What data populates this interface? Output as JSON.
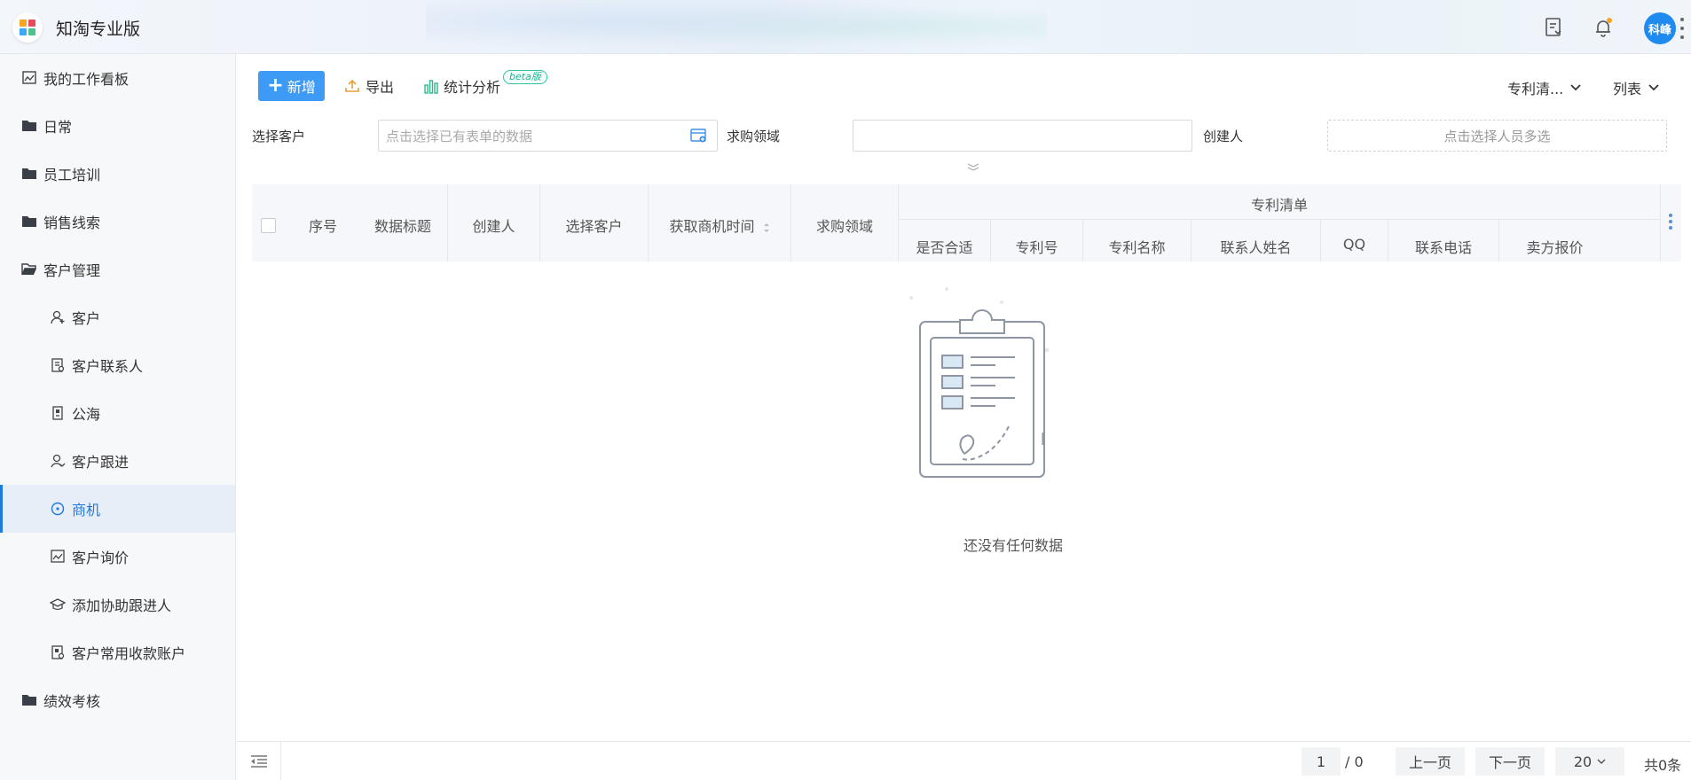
{
  "app": {
    "title": "知淘专业版",
    "user_avatar": "科峰"
  },
  "colors": {
    "accent": "#1f7ae0",
    "primary_button": "#3d9bf5",
    "beta": "#19b393"
  },
  "sidebar": {
    "items": [
      {
        "label": "我的工作看板",
        "icon": "dashboard-icon"
      },
      {
        "label": "日常",
        "icon": "folder-icon"
      },
      {
        "label": "员工培训",
        "icon": "folder-icon"
      },
      {
        "label": "销售线索",
        "icon": "folder-icon"
      },
      {
        "label": "客户管理",
        "icon": "folder-open-icon"
      },
      {
        "label": "客户",
        "icon": "user-plus-icon"
      },
      {
        "label": "客户联系人",
        "icon": "contact-card-icon"
      },
      {
        "label": "公海",
        "icon": "phone-book-icon"
      },
      {
        "label": "客户跟进",
        "icon": "user-follow-icon"
      },
      {
        "label": "商机",
        "icon": "target-icon",
        "active": true
      },
      {
        "label": "客户询价",
        "icon": "chart-line-icon"
      },
      {
        "label": "添加协助跟进人",
        "icon": "graduation-cap-icon"
      },
      {
        "label": "客户常用收款账户",
        "icon": "account-card-icon"
      },
      {
        "label": "绩效考核",
        "icon": "folder-icon"
      }
    ]
  },
  "toolbar": {
    "new_label": "新增",
    "export_label": "导出",
    "stats_label": "统计分析",
    "beta_label": "beta版",
    "view_select": "专利清...",
    "layout_select": "列表"
  },
  "filters": {
    "customer_label": "选择客户",
    "customer_placeholder": "点击选择已有表单的数据",
    "domain_label": "求购领域",
    "domain_value": "",
    "creator_label": "创建人",
    "creator_placeholder": "点击选择人员多选"
  },
  "table": {
    "columns": [
      "序号",
      "数据标题",
      "创建人",
      "选择客户",
      "获取商机时间",
      "求购领域"
    ],
    "group_header": "专利清单",
    "group_columns": [
      "是否合适",
      "专利号",
      "专利名称",
      "联系人姓名",
      "QQ",
      "联系电话",
      "卖方报价"
    ]
  },
  "empty_state": {
    "message": "还没有任何数据"
  },
  "pagination": {
    "current_page": "1",
    "total_pages": "/ 0",
    "prev_label": "上一页",
    "next_label": "下一页",
    "page_size": "20",
    "total": "共0条"
  }
}
